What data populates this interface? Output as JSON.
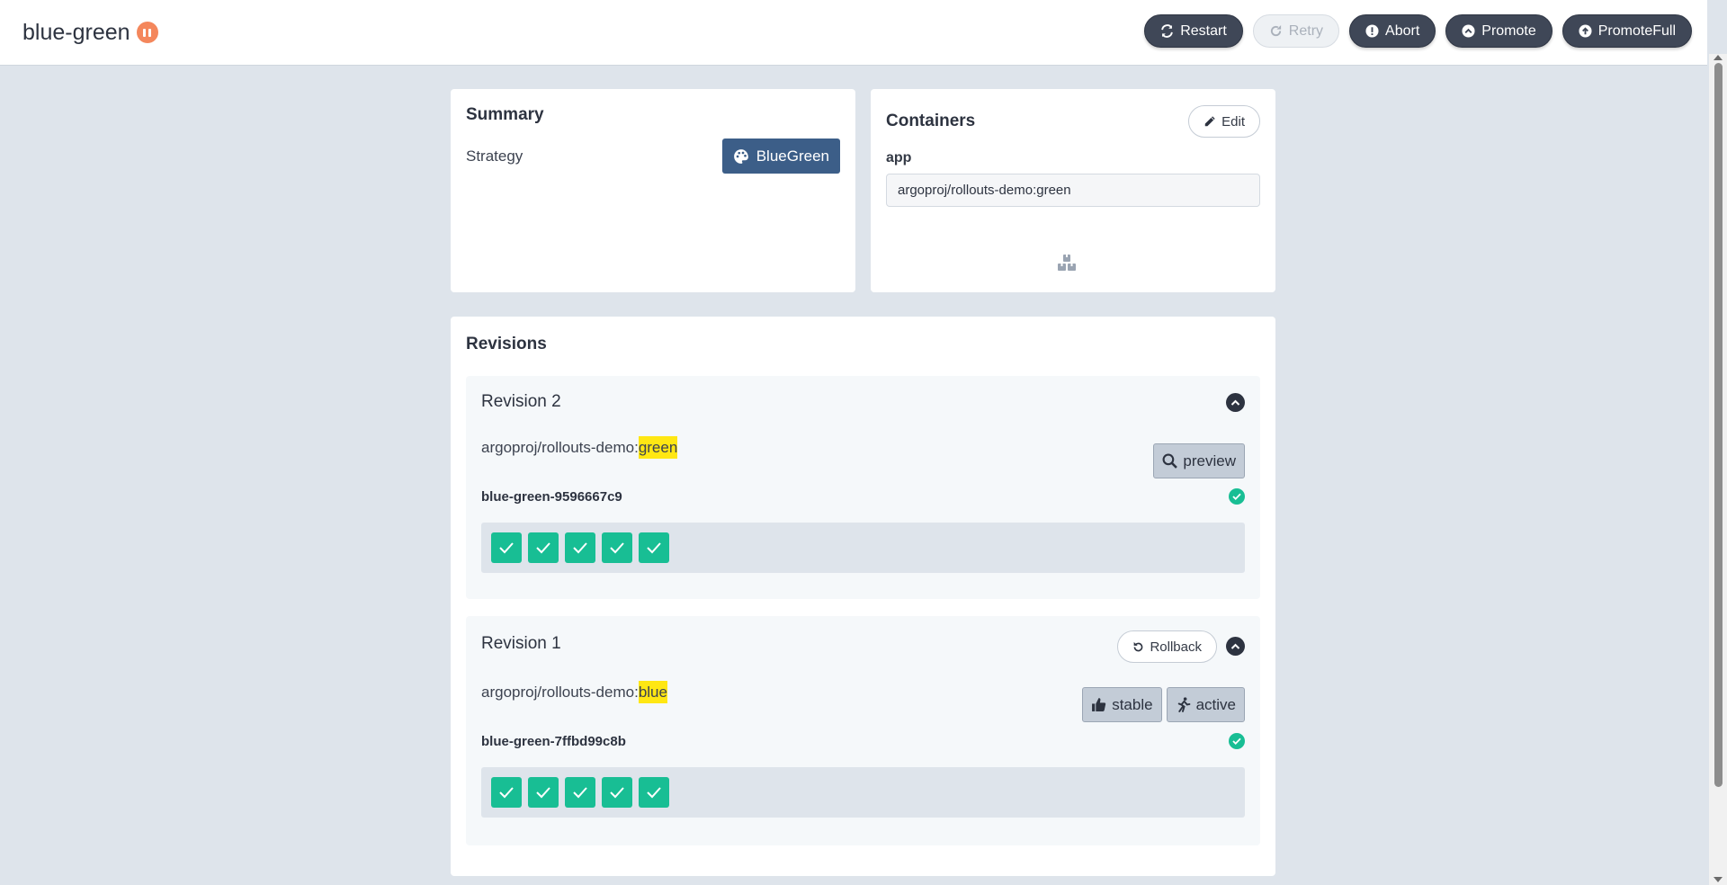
{
  "header": {
    "title": "blue-green",
    "status_icon": "pause-icon",
    "actions": [
      {
        "label": "Restart",
        "icon": "sync-icon",
        "enabled": true
      },
      {
        "label": "Retry",
        "icon": "redo-icon",
        "enabled": false
      },
      {
        "label": "Abort",
        "icon": "exclamation-circle-icon",
        "enabled": true
      },
      {
        "label": "Promote",
        "icon": "chevron-circle-up-icon",
        "enabled": true
      },
      {
        "label": "PromoteFull",
        "icon": "arrow-circle-up-icon",
        "enabled": true
      }
    ]
  },
  "summary": {
    "title": "Summary",
    "strategy_label": "Strategy",
    "strategy_value": "BlueGreen",
    "strategy_icon": "palette-icon"
  },
  "containers": {
    "title": "Containers",
    "edit_label": "Edit",
    "container_name": "app",
    "image_value": "argoproj/rollouts-demo:green"
  },
  "revisions": {
    "title": "Revisions",
    "items": [
      {
        "title": "Revision 2",
        "image_prefix": "argoproj/rollouts-demo:",
        "image_tag": "green",
        "tags": [
          {
            "label": "preview",
            "icon": "search-icon"
          }
        ],
        "replicaset": "blue-green-9596667c9",
        "pods_ready": 5,
        "status": "healthy"
      },
      {
        "title": "Revision 1",
        "rollback_label": "Rollback",
        "image_prefix": "argoproj/rollouts-demo:",
        "image_tag": "blue",
        "tags": [
          {
            "label": "stable",
            "icon": "thumbs-up-icon"
          },
          {
            "label": "active",
            "icon": "running-icon"
          }
        ],
        "replicaset": "blue-green-7ffbd99c8b",
        "pods_ready": 5,
        "status": "healthy"
      }
    ]
  },
  "colors": {
    "accent_dark": "#3f4757",
    "strategy": "#3c5e88",
    "healthy": "#18be94",
    "paused": "#f4875c",
    "highlight": "#ffe713"
  }
}
